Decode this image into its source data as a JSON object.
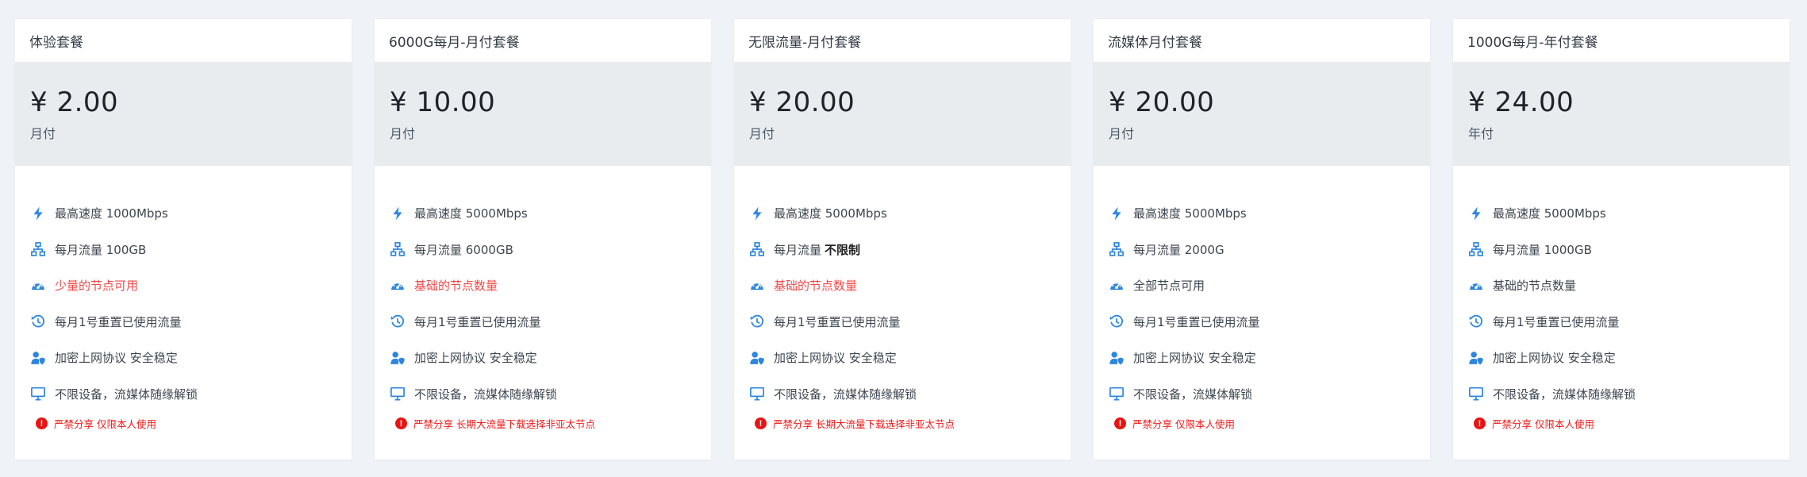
{
  "colors": {
    "accent": "#2e86de",
    "danger": "#f04a4a",
    "notice": "#f11b1b",
    "page_bg": "#eff2f7",
    "price_bg": "#e9ecef"
  },
  "plans": [
    {
      "title": "体验套餐",
      "price": "¥ 2.00",
      "period": "月付",
      "features": {
        "speed": "最高速度 1000Mbps",
        "traffic": "每月流量 100GB",
        "traffic_strong": "",
        "nodes": "少量的节点可用",
        "reset": "每月1号重置已使用流量",
        "protocol": "加密上网协议 安全稳定",
        "devices": "不限设备，流媒体随缘解锁"
      },
      "nodes_danger": true,
      "notice": "严禁分享 仅限本人使用"
    },
    {
      "title": "6000G每月-月付套餐",
      "price": "¥ 10.00",
      "period": "月付",
      "features": {
        "speed": "最高速度 5000Mbps",
        "traffic": "每月流量 6000GB",
        "traffic_strong": "",
        "nodes": "基础的节点数量",
        "reset": "每月1号重置已使用流量",
        "protocol": "加密上网协议 安全稳定",
        "devices": "不限设备，流媒体随缘解锁"
      },
      "nodes_danger": true,
      "notice": "严禁分享 长期大流量下载选择非亚太节点"
    },
    {
      "title": "无限流量-月付套餐",
      "price": "¥ 20.00",
      "period": "月付",
      "features": {
        "speed": "最高速度 5000Mbps",
        "traffic": "每月流量",
        "traffic_strong": "不限制",
        "nodes": "基础的节点数量",
        "reset": "每月1号重置已使用流量",
        "protocol": "加密上网协议 安全稳定",
        "devices": "不限设备，流媒体随缘解锁"
      },
      "nodes_danger": true,
      "notice": "严禁分享 长期大流量下载选择非亚太节点"
    },
    {
      "title": "流媒体月付套餐",
      "price": "¥ 20.00",
      "period": "月付",
      "features": {
        "speed": "最高速度 5000Mbps",
        "traffic": "每月流量 2000G",
        "traffic_strong": "",
        "nodes": "全部节点可用",
        "reset": "每月1号重置已使用流量",
        "protocol": "加密上网协议 安全稳定",
        "devices": "不限设备，流媒体解锁"
      },
      "nodes_danger": false,
      "notice": "严禁分享 仅限本人使用"
    },
    {
      "title": "1000G每月-年付套餐",
      "price": "¥ 24.00",
      "period": "年付",
      "features": {
        "speed": "最高速度 5000Mbps",
        "traffic": "每月流量 1000GB",
        "traffic_strong": "",
        "nodes": "基础的节点数量",
        "reset": "每月1号重置已使用流量",
        "protocol": "加密上网协议 安全稳定",
        "devices": "不限设备，流媒体随缘解锁"
      },
      "nodes_danger": false,
      "notice": "严禁分享 仅限本人使用"
    }
  ]
}
